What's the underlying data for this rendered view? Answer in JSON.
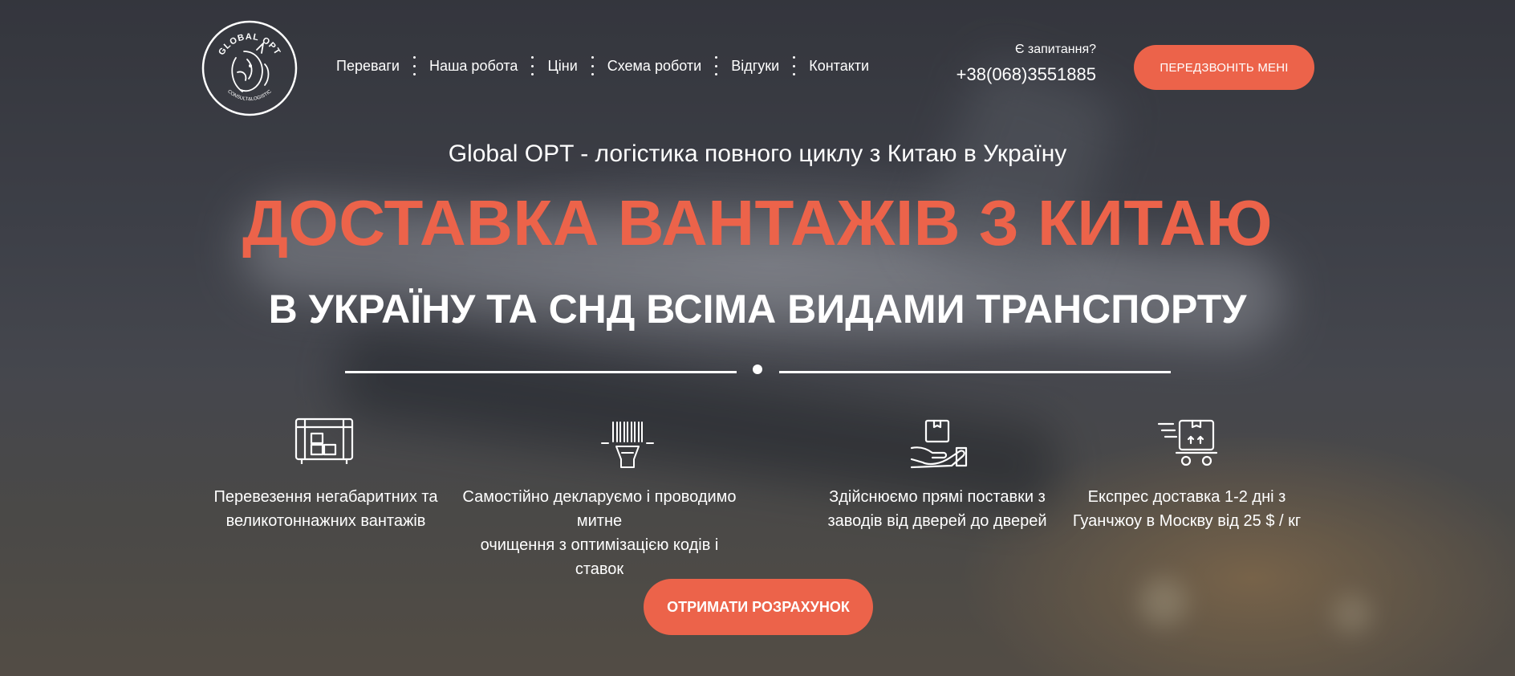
{
  "brand": {
    "logo_text_top": "GLOBAL OPT",
    "logo_text_bottom": "CONSULT&LOGISTIC"
  },
  "nav": {
    "items": [
      {
        "label": "Переваги"
      },
      {
        "label": "Наша робота"
      },
      {
        "label": "Ціни"
      },
      {
        "label": "Схема роботи"
      },
      {
        "label": "Відгуки"
      },
      {
        "label": "Контакти"
      }
    ]
  },
  "contact": {
    "question": "Є запитання?",
    "phone": "+38(068)3551885",
    "callback_button": "ПЕРЕДЗВОНІТЬ МЕНІ"
  },
  "hero": {
    "subtitle": "Global OPT - логістика повного циклу з Китаю в Україну",
    "title": "ДОСТАВКА ВАНТАЖІВ З КИТАЮ",
    "title2": "В УКРАЇНУ ТА СНД ВСІМА ВИДАМИ ТРАНСПОРТУ"
  },
  "features": [
    {
      "icon": "oversized-cargo-icon",
      "line1": "Перевезення негабаритних та",
      "line2": "великотоннажних вантажів"
    },
    {
      "icon": "barcode-scanner-icon",
      "line1": "Самостійно декларуємо і проводимо митне",
      "line2": "очищення з оптимізацією кодів і ставок"
    },
    {
      "icon": "hand-box-icon",
      "line1": "Здійснюємо прямі поставки з",
      "line2": "заводів від дверей до дверей"
    },
    {
      "icon": "express-delivery-icon",
      "line1": "Експрес доставка 1-2 дні з",
      "line2": "Гуанчжоу в Москву від 25 $ / кг"
    }
  ],
  "cta": {
    "label": "ОТРИМАТИ РОЗРАХУНОК"
  },
  "colors": {
    "accent": "#ec634a",
    "text": "#ffffff",
    "background": "#3d3f47"
  }
}
